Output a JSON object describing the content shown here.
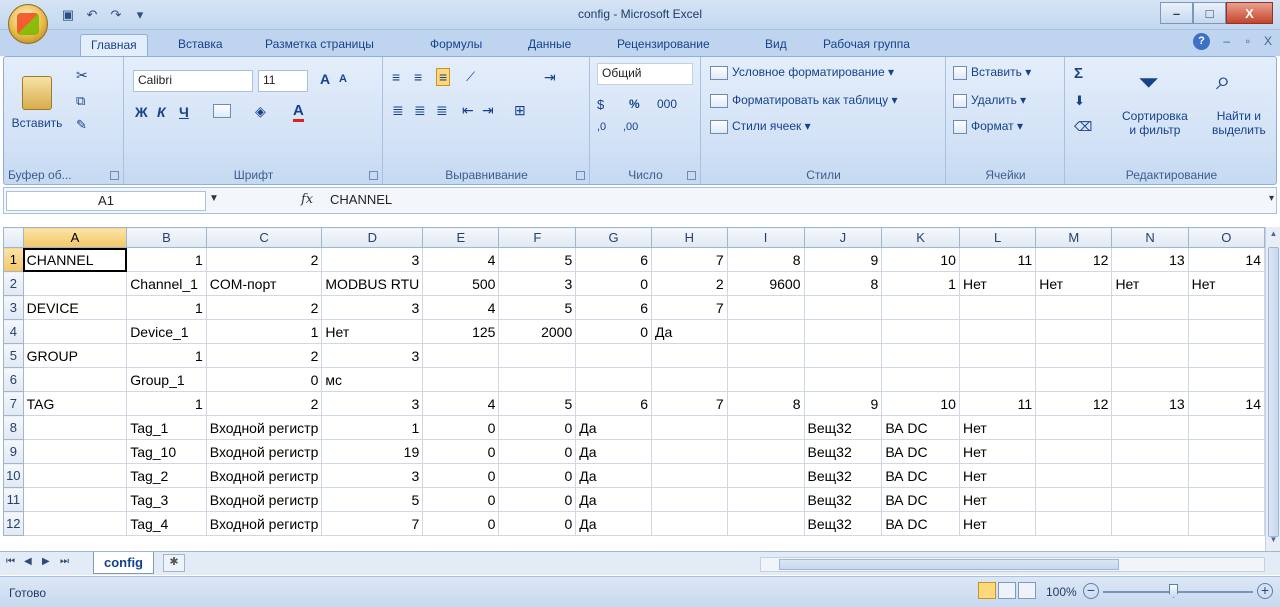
{
  "window": {
    "title": "config - Microsoft Excel",
    "minimize": "–",
    "maximize": "□",
    "close": "X"
  },
  "ribbon_tabs": [
    "Главная",
    "Вставка",
    "Разметка страницы",
    "Формулы",
    "Данные",
    "Рецензирование",
    "Вид",
    "Рабочая группа"
  ],
  "ribbon_right": {
    "help": "?",
    "min": "–",
    "restore": "▫",
    "close": "X"
  },
  "clipboard": {
    "paste": "Вставить",
    "label": "Буфер об..."
  },
  "font": {
    "name": "Calibri",
    "size": "11",
    "bold": "Ж",
    "italic": "К",
    "underline": "Ч",
    "grow": "A",
    "shrink": "A",
    "color": "A",
    "label": "Шрифт"
  },
  "alignment": {
    "label": "Выравнивание"
  },
  "number": {
    "format": "Общий",
    "percent": "%",
    "thousands": "000",
    "inc": ",0",
    "dec": ",00",
    "label": "Число"
  },
  "styles": {
    "conditional": "Условное форматирование",
    "as_table": "Форматировать как таблицу",
    "cell_styles": "Стили ячеек",
    "label": "Стили"
  },
  "cells": {
    "insert": "Вставить",
    "delete": "Удалить",
    "format": "Формат",
    "label": "Ячейки"
  },
  "editing": {
    "sigma": "Σ",
    "sort": "Сортировка",
    "sort2": "и фильтр",
    "find": "Найти и",
    "find2": "выделить",
    "label": "Редактирование"
  },
  "formula_bar": {
    "name_box": "A1",
    "fx": "fx",
    "value": "CHANNEL"
  },
  "columns": [
    "A",
    "B",
    "C",
    "D",
    "E",
    "F",
    "G",
    "H",
    "I",
    "J",
    "K",
    "L",
    "M",
    "N",
    "O"
  ],
  "rows": [
    {
      "n": "1",
      "cells": [
        "CHANNEL",
        "1",
        "2",
        "3",
        "4",
        "5",
        "6",
        "7",
        "8",
        "9",
        "10",
        "11",
        "12",
        "13",
        "14"
      ]
    },
    {
      "n": "2",
      "cells": [
        "",
        "Channel_1",
        "COM-порт",
        "MODBUS RTU",
        "500",
        "3",
        "0",
        "2",
        "9600",
        "8",
        "1",
        "Нет",
        "Нет",
        "Нет",
        "Нет"
      ]
    },
    {
      "n": "3",
      "cells": [
        "DEVICE",
        "1",
        "2",
        "3",
        "4",
        "5",
        "6",
        "7",
        "",
        "",
        "",
        "",
        "",
        "",
        ""
      ]
    },
    {
      "n": "4",
      "cells": [
        "",
        "Device_1",
        "1",
        "Нет",
        "125",
        "2000",
        "0",
        "Да",
        "",
        "",
        "",
        "",
        "",
        "",
        ""
      ]
    },
    {
      "n": "5",
      "cells": [
        "GROUP",
        "1",
        "2",
        "3",
        "",
        "",
        "",
        "",
        "",
        "",
        "",
        "",
        "",
        "",
        ""
      ]
    },
    {
      "n": "6",
      "cells": [
        "",
        "Group_1",
        "0",
        "мс",
        "",
        "",
        "",
        "",
        "",
        "",
        "",
        "",
        "",
        "",
        ""
      ]
    },
    {
      "n": "7",
      "cells": [
        "TAG",
        "1",
        "2",
        "3",
        "4",
        "5",
        "6",
        "7",
        "8",
        "9",
        "10",
        "11",
        "12",
        "13",
        "14"
      ]
    },
    {
      "n": "8",
      "cells": [
        "",
        "Tag_1",
        "Входной регистр",
        "1",
        "0",
        "0",
        "Да",
        "",
        "",
        "Вещ32",
        "ВА DC",
        "Нет",
        "",
        "",
        ""
      ]
    },
    {
      "n": "9",
      "cells": [
        "",
        "Tag_10",
        "Входной регистр",
        "19",
        "0",
        "0",
        "Да",
        "",
        "",
        "Вещ32",
        "ВА DC",
        "Нет",
        "",
        "",
        ""
      ]
    },
    {
      "n": "10",
      "cells": [
        "",
        "Tag_2",
        "Входной регистр",
        "3",
        "0",
        "0",
        "Да",
        "",
        "",
        "Вещ32",
        "ВА DC",
        "Нет",
        "",
        "",
        ""
      ]
    },
    {
      "n": "11",
      "cells": [
        "",
        "Tag_3",
        "Входной регистр",
        "5",
        "0",
        "0",
        "Да",
        "",
        "",
        "Вещ32",
        "ВА DC",
        "Нет",
        "",
        "",
        ""
      ]
    },
    {
      "n": "12",
      "cells": [
        "",
        "Tag_4",
        "Входной регистр",
        "7",
        "0",
        "0",
        "Да",
        "",
        "",
        "Вещ32",
        "ВА DC",
        "Нет",
        "",
        "",
        ""
      ]
    }
  ],
  "sheet": {
    "name": "config"
  },
  "status": {
    "text": "Готово",
    "zoom": "100%",
    "minus": "−",
    "plus": "+"
  }
}
